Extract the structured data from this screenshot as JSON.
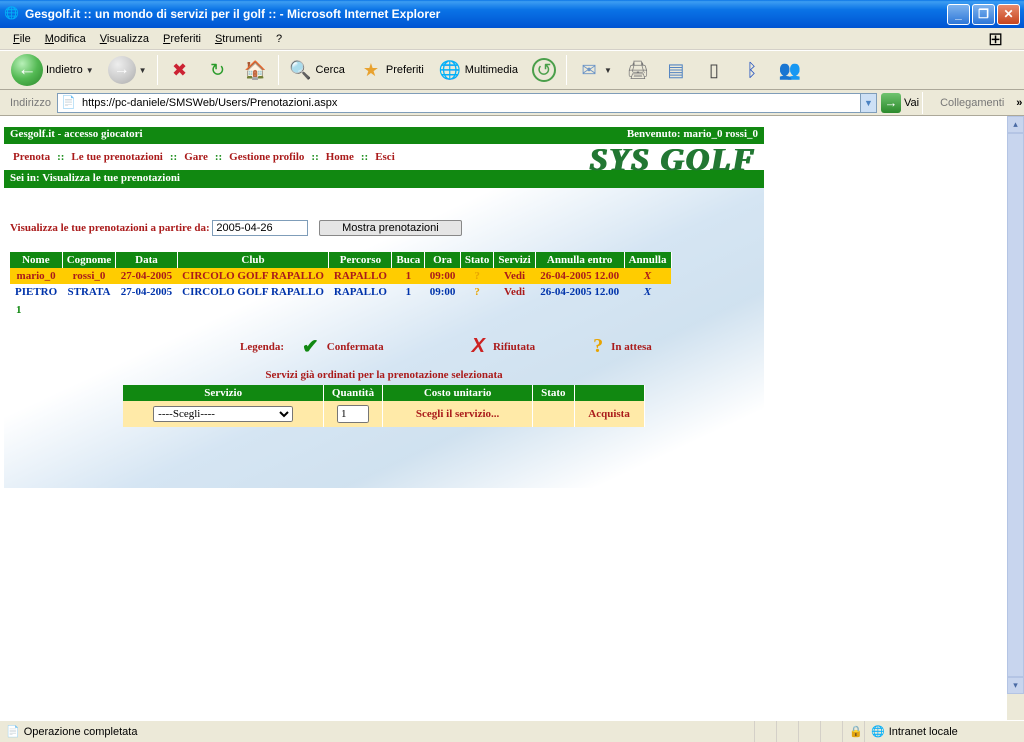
{
  "window_title": "Gesgolf.it :: un mondo di servizi per il golf :: - Microsoft Internet Explorer",
  "menu": {
    "file": "File",
    "modifica": "Modifica",
    "visualizza": "Visualizza",
    "preferiti": "Preferiti",
    "strumenti": "Strumenti",
    "help": "?"
  },
  "toolbar": {
    "back": "Indietro",
    "search": "Cerca",
    "favorites": "Preferiti",
    "multimedia": "Multimedia"
  },
  "address": {
    "label": "Indirizzo",
    "url": "https://pc-daniele/SMSWeb/Users/Prenotazioni.aspx",
    "go": "Vai",
    "links": "Collegamenti"
  },
  "page": {
    "header_left": "Gesgolf.it - accesso giocatori",
    "header_right": "Benvenuto: mario_0 rossi_0",
    "logo": "SYS GOLF",
    "nav": {
      "prenota": "Prenota",
      "tue": "Le tue prenotazioni",
      "gare": "Gare",
      "profilo": "Gestione profilo",
      "home": "Home",
      "esci": "Esci"
    },
    "crumb": "Sei in: Visualizza le tue prenotazioni",
    "filter_label": "Visualizza le tue prenotazioni a partire da:",
    "filter_date": "2005-04-26",
    "filter_btn": "Mostra prenotazioni",
    "cols": {
      "nome": "Nome",
      "cognome": "Cognome",
      "data": "Data",
      "club": "Club",
      "percorso": "Percorso",
      "buca": "Buca",
      "ora": "Ora",
      "stato": "Stato",
      "servizi": "Servizi",
      "annulla_entro": "Annulla entro",
      "annulla": "Annulla"
    },
    "rows": [
      {
        "nome": "mario_0",
        "cognome": "rossi_0",
        "data": "27-04-2005",
        "club": "CIRCOLO GOLF RAPALLO",
        "percorso": "RAPALLO",
        "buca": "1",
        "ora": "09:00",
        "stato": "?",
        "servizi": "Vedi",
        "annulla_entro": "26-04-2005 12.00",
        "annulla": "X"
      },
      {
        "nome": "PIETRO",
        "cognome": "STRATA",
        "data": "27-04-2005",
        "club": "CIRCOLO GOLF RAPALLO",
        "percorso": "RAPALLO",
        "buca": "1",
        "ora": "09:00",
        "stato": "?",
        "servizi": "Vedi",
        "annulla_entro": "26-04-2005 12.00",
        "annulla": "X"
      }
    ],
    "pager": "1",
    "legend": {
      "label": "Legenda:",
      "ok": "Confermata",
      "no": "Rifiutata",
      "wait": "In attesa"
    },
    "services_title": "Servizi già ordinati per la prenotazione selezionata",
    "svc_cols": {
      "servizio": "Servizio",
      "quantita": "Quantità",
      "costo": "Costo unitario",
      "stato": "Stato",
      "azione": ""
    },
    "svc_row": {
      "select_option": "----Scegli----",
      "qty": "1",
      "hint": "Scegli il servizio...",
      "acquista": "Acquista"
    }
  },
  "status": {
    "msg": "Operazione completata",
    "zone": "Intranet locale"
  }
}
